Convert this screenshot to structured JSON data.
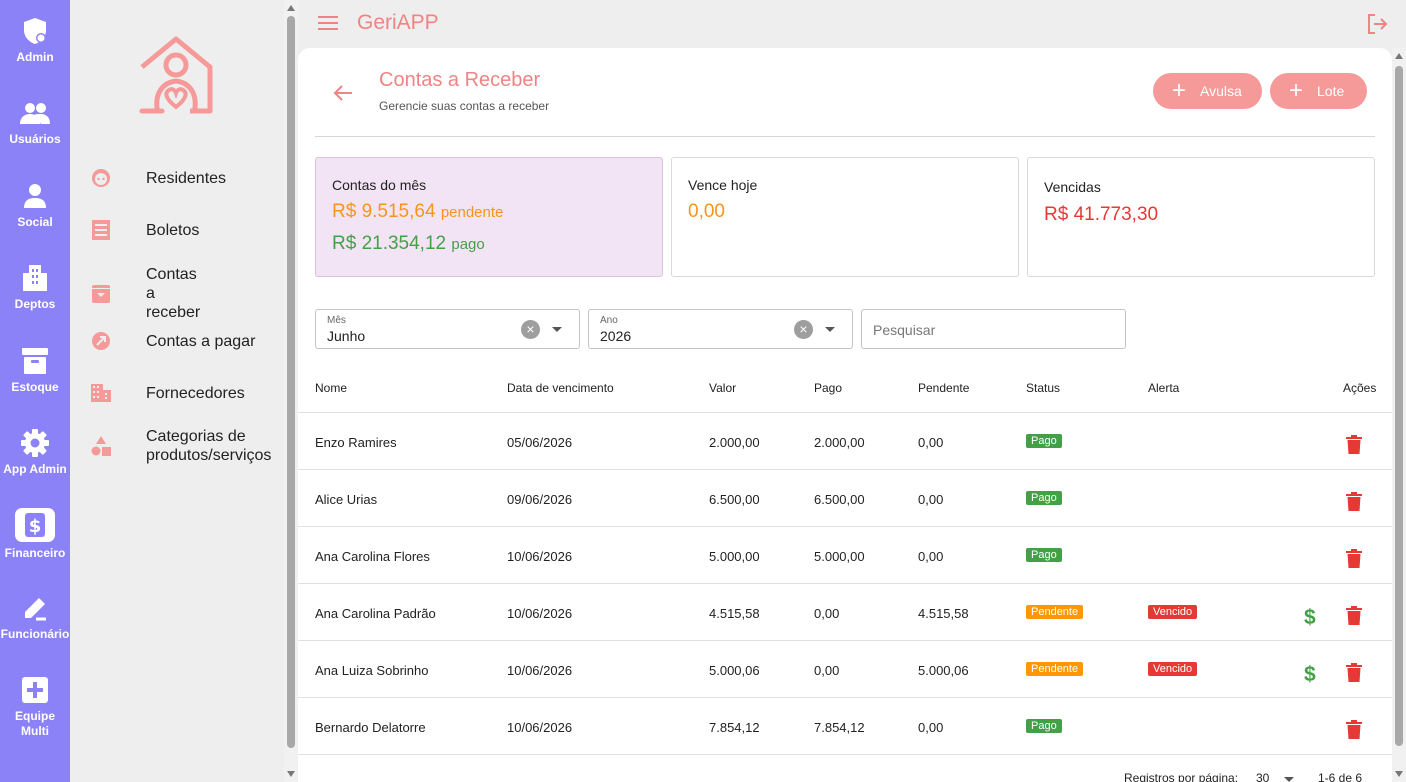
{
  "rail": {
    "items": [
      {
        "label": "Admin"
      },
      {
        "label": "Usuários"
      },
      {
        "label": "Social"
      },
      {
        "label": "Deptos"
      },
      {
        "label": "Estoque"
      },
      {
        "label": "App Admin"
      },
      {
        "label": "Financeiro"
      },
      {
        "label": "Funcionário"
      },
      {
        "label": "Equipe Multi"
      }
    ]
  },
  "menu": {
    "items": [
      {
        "label": "Residentes",
        "icon": "face-icon"
      },
      {
        "label": "Boletos",
        "icon": "receipt-icon"
      },
      {
        "label": "Contas a receber",
        "icon": "archive-in-icon"
      },
      {
        "label": "Contas a pagar",
        "icon": "arrow-out-icon"
      },
      {
        "label": "Fornecedores",
        "icon": "building-icon"
      },
      {
        "label": "Categorias de produtos/serviços",
        "icon": "shapes-icon"
      }
    ]
  },
  "header": {
    "app_title": "GeriAPP"
  },
  "page": {
    "title": "Contas a Receber",
    "subtitle": "Gerencie suas contas a receber",
    "btn_avulsa": "Avulsa",
    "btn_lote": "Lote"
  },
  "summary": {
    "month_label": "Contas do mês",
    "pending_value": "R$ 9.515,64",
    "pending_suffix": "pendente",
    "paid_value": "R$ 21.354,12",
    "paid_suffix": "pago",
    "today_label": "Vence hoje",
    "today_value": "0,00",
    "overdue_label": "Vencidas",
    "overdue_value": "R$ 41.773,30"
  },
  "filters": {
    "month_label": "Mês",
    "month_value": "Junho",
    "year_label": "Ano",
    "year_value": "2026",
    "search_placeholder": "Pesquisar"
  },
  "table": {
    "headers": {
      "nome": "Nome",
      "vencimento": "Data de vencimento",
      "valor": "Valor",
      "pago": "Pago",
      "pendente": "Pendente",
      "status": "Status",
      "alerta": "Alerta",
      "acoes": "Ações"
    },
    "rows": [
      {
        "nome": "Enzo Ramires",
        "vencimento": "05/06/2026",
        "valor": "2.000,00",
        "pago": "2.000,00",
        "pendente": "0,00",
        "status": "Pago",
        "alerta": ""
      },
      {
        "nome": "Alice Urias",
        "vencimento": "09/06/2026",
        "valor": "6.500,00",
        "pago": "6.500,00",
        "pendente": "0,00",
        "status": "Pago",
        "alerta": ""
      },
      {
        "nome": "Ana Carolina Flores",
        "vencimento": "10/06/2026",
        "valor": "5.000,00",
        "pago": "5.000,00",
        "pendente": "0,00",
        "status": "Pago",
        "alerta": ""
      },
      {
        "nome": "Ana Carolina Padrão",
        "vencimento": "10/06/2026",
        "valor": "4.515,58",
        "pago": "0,00",
        "pendente": "4.515,58",
        "status": "Pendente",
        "alerta": "Vencido"
      },
      {
        "nome": "Ana Luiza Sobrinho",
        "vencimento": "10/06/2026",
        "valor": "5.000,06",
        "pago": "0,00",
        "pendente": "5.000,06",
        "status": "Pendente",
        "alerta": "Vencido"
      },
      {
        "nome": "Bernardo Delatorre",
        "vencimento": "10/06/2026",
        "valor": "7.854,12",
        "pago": "7.854,12",
        "pendente": "0,00",
        "status": "Pago",
        "alerta": ""
      }
    ]
  },
  "pagination": {
    "rows_label": "Registros por página:",
    "rows_value": "30",
    "range": "1-6 de 6"
  },
  "colors": {
    "rail": "#8c82f7",
    "accent": "#f08383",
    "button": "#f59a98",
    "pending": "#f7941d",
    "paid": "#43a047",
    "overdue": "#e53935"
  }
}
